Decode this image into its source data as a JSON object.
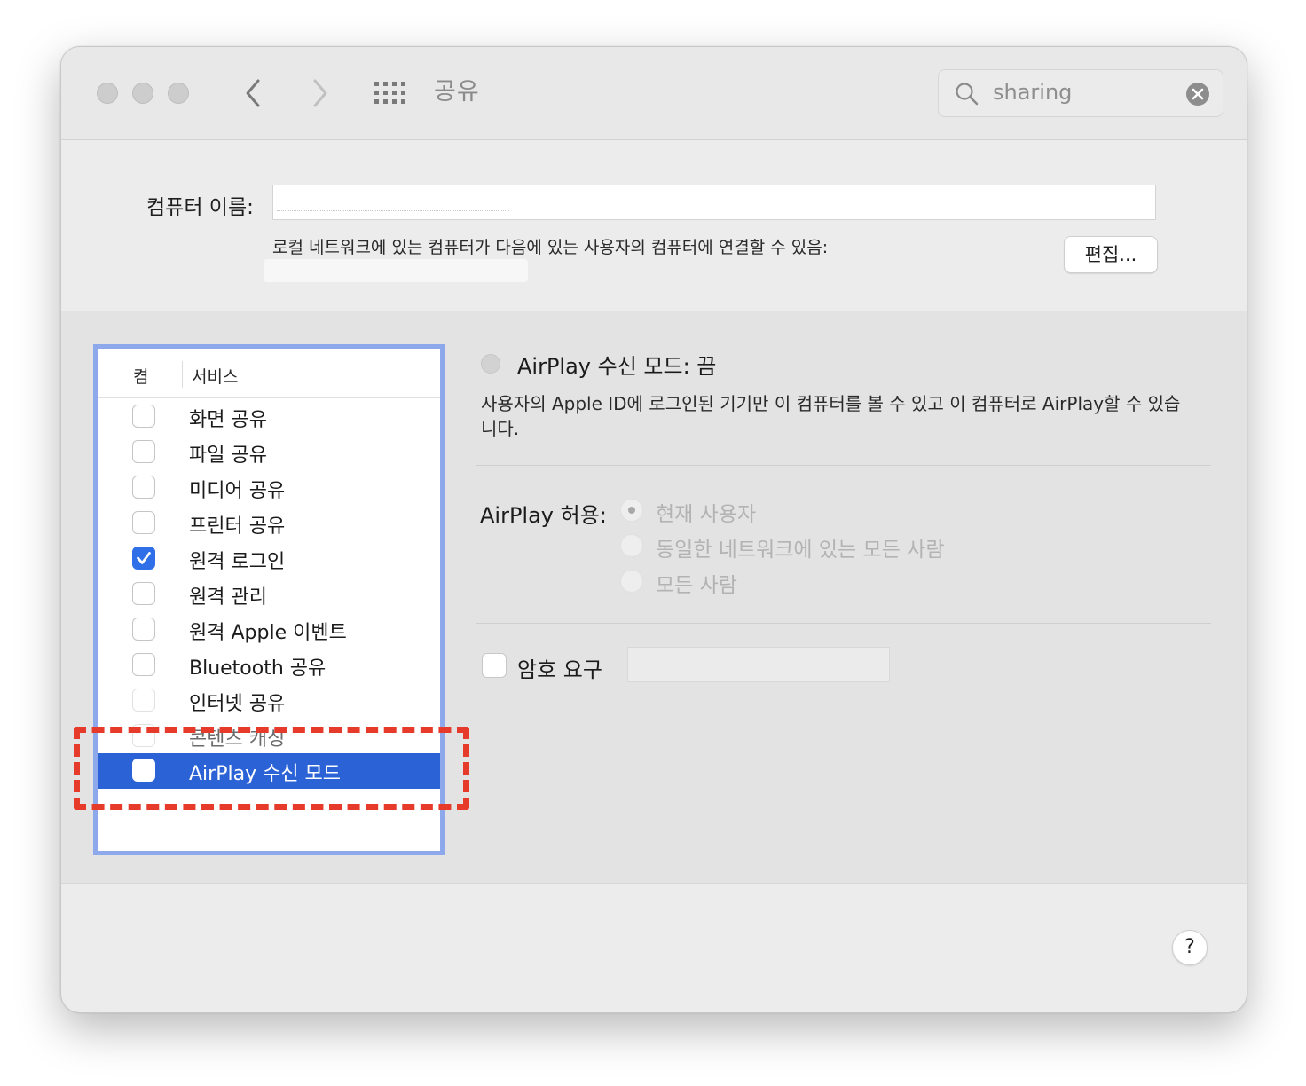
{
  "toolbar": {
    "title": "공유",
    "search_value": "sharing",
    "icons": [
      "back-chevron",
      "forward-chevron",
      "grid-icon",
      "search-icon",
      "clear-icon"
    ]
  },
  "computer_name": {
    "label": "컴퓨터 이름:",
    "description": "로컬 네트워크에 있는 컴퓨터가 다음에 있는 사용자의 컴퓨터에 연결할 수 있음:",
    "edit_label": "편집..."
  },
  "services": {
    "header_on": "켬",
    "header_service": "서비스",
    "items": [
      {
        "label": "화면 공유",
        "checked": false
      },
      {
        "label": "파일 공유",
        "checked": false
      },
      {
        "label": "미디어 공유",
        "checked": false
      },
      {
        "label": "프린터 공유",
        "checked": false
      },
      {
        "label": "원격 로그인",
        "checked": true
      },
      {
        "label": "원격 관리",
        "checked": false
      },
      {
        "label": "원격 Apple 이벤트",
        "checked": false
      },
      {
        "label": "Bluetooth 공유",
        "checked": false
      },
      {
        "label": "인터넷 공유",
        "checked": false
      },
      {
        "label": "콘텐츠 캐싱",
        "checked": false
      },
      {
        "label": "AirPlay 수신 모드",
        "checked": false,
        "selected": true
      }
    ]
  },
  "detail": {
    "status": "AirPlay 수신 모드: 끔",
    "info": "사용자의 Apple ID에 로그인된 기기만 이 컴퓨터를 볼 수 있고 이 컴퓨터로 AirPlay할 수 있습니다.",
    "allow_label": "AirPlay 허용:",
    "allow_options": [
      {
        "label": "현재 사용자",
        "selected": true
      },
      {
        "label": "동일한 네트워크에 있는 모든 사람",
        "selected": false
      },
      {
        "label": "모든 사람",
        "selected": false
      }
    ],
    "password_label": "암호 요구"
  },
  "help_label": "?",
  "colors": {
    "selection": "#2b63d7",
    "list_focus_ring": "#8ea8ec",
    "annotation": "#e63a2a",
    "checkbox_checked": "#2f6fe8"
  }
}
